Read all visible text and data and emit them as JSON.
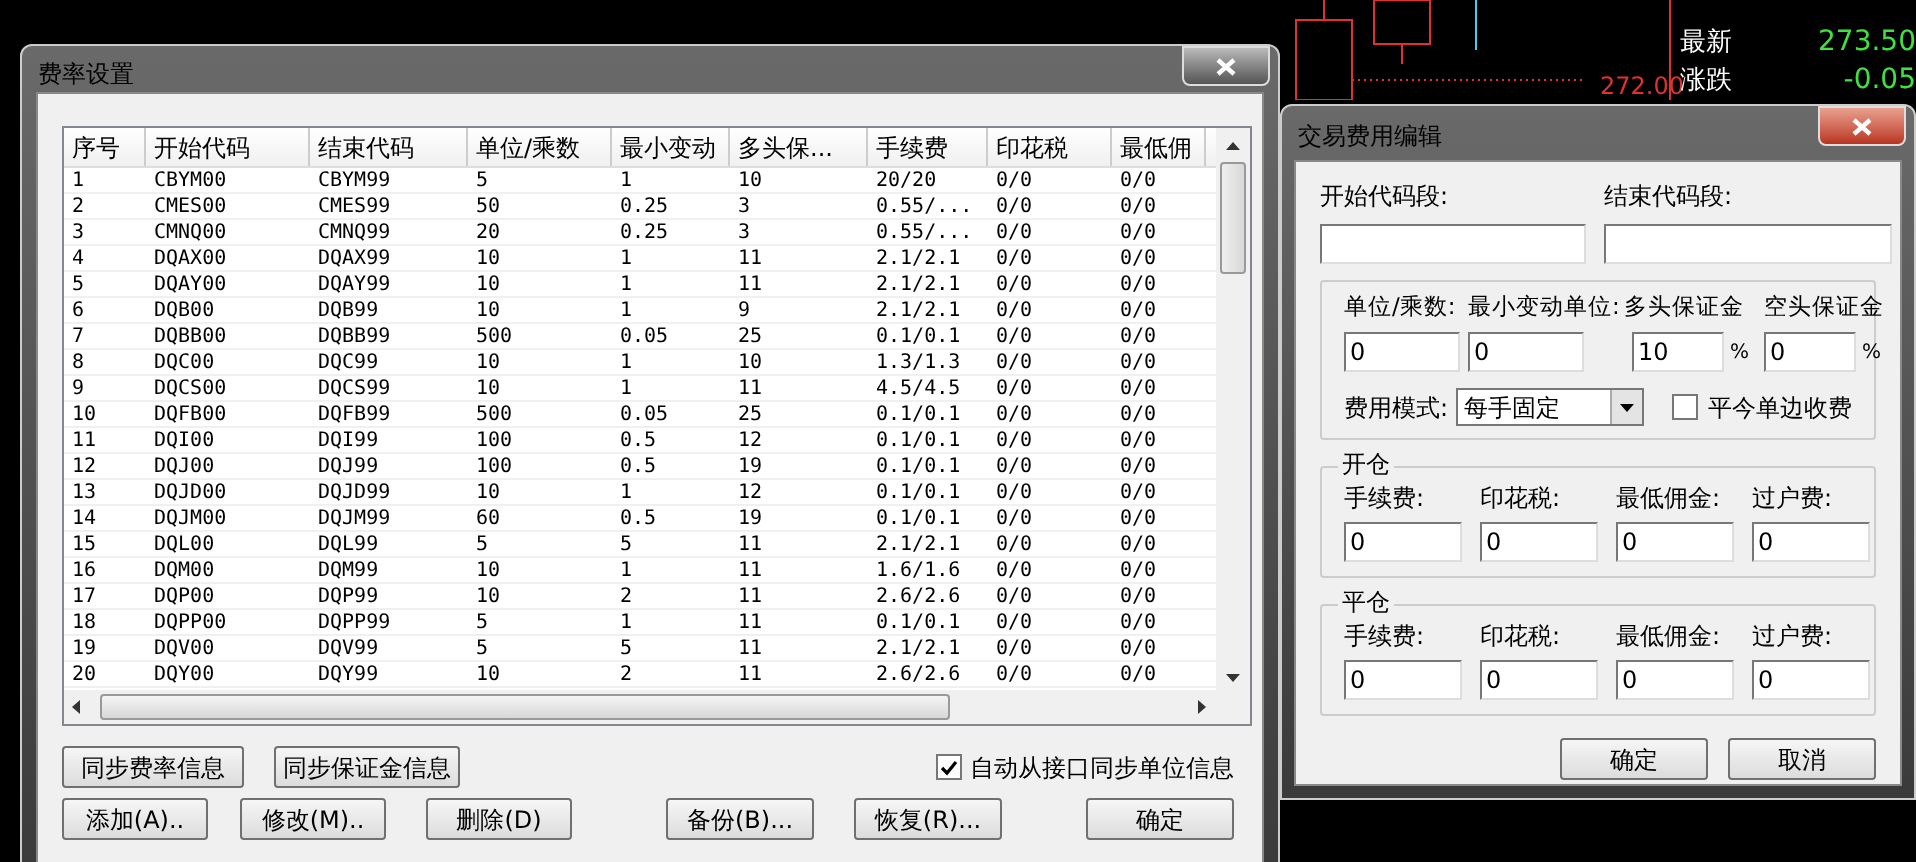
{
  "market_panel": {
    "quotes": [
      {
        "label": "最新",
        "value": "273.50"
      },
      {
        "label": "涨跌",
        "value": "-0.05"
      }
    ],
    "price_line": "272.00"
  },
  "fee_dialog": {
    "title": "费率设置",
    "table": {
      "columns": [
        "序号",
        "开始代码",
        "结束代码",
        "单位/乘数",
        "最小变动",
        "多头保...",
        "手续费",
        "印花税",
        "最低佣"
      ],
      "rows": [
        [
          "1",
          "CBYM00",
          "CBYM99",
          "5",
          "1",
          "10",
          "20/20",
          "0/0",
          "0/0"
        ],
        [
          "2",
          "CMES00",
          "CMES99",
          "50",
          "0.25",
          "3",
          "0.55/...",
          "0/0",
          "0/0"
        ],
        [
          "3",
          "CMNQ00",
          "CMNQ99",
          "20",
          "0.25",
          "3",
          "0.55/...",
          "0/0",
          "0/0"
        ],
        [
          "4",
          "DQAX00",
          "DQAX99",
          "10",
          "1",
          "11",
          "2.1/2.1",
          "0/0",
          "0/0"
        ],
        [
          "5",
          "DQAY00",
          "DQAY99",
          "10",
          "1",
          "11",
          "2.1/2.1",
          "0/0",
          "0/0"
        ],
        [
          "6",
          "DQB00",
          "DQB99",
          "10",
          "1",
          "9",
          "2.1/2.1",
          "0/0",
          "0/0"
        ],
        [
          "7",
          "DQBB00",
          "DQBB99",
          "500",
          "0.05",
          "25",
          "0.1/0.1",
          "0/0",
          "0/0"
        ],
        [
          "8",
          "DQC00",
          "DQC99",
          "10",
          "1",
          "10",
          "1.3/1.3",
          "0/0",
          "0/0"
        ],
        [
          "9",
          "DQCS00",
          "DQCS99",
          "10",
          "1",
          "11",
          "4.5/4.5",
          "0/0",
          "0/0"
        ],
        [
          "10",
          "DQFB00",
          "DQFB99",
          "500",
          "0.05",
          "25",
          "0.1/0.1",
          "0/0",
          "0/0"
        ],
        [
          "11",
          "DQI00",
          "DQI99",
          "100",
          "0.5",
          "12",
          "0.1/0.1",
          "0/0",
          "0/0"
        ],
        [
          "12",
          "DQJ00",
          "DQJ99",
          "100",
          "0.5",
          "19",
          "0.1/0.1",
          "0/0",
          "0/0"
        ],
        [
          "13",
          "DQJD00",
          "DQJD99",
          "10",
          "1",
          "12",
          "0.1/0.1",
          "0/0",
          "0/0"
        ],
        [
          "14",
          "DQJM00",
          "DQJM99",
          "60",
          "0.5",
          "19",
          "0.1/0.1",
          "0/0",
          "0/0"
        ],
        [
          "15",
          "DQL00",
          "DQL99",
          "5",
          "5",
          "11",
          "2.1/2.1",
          "0/0",
          "0/0"
        ],
        [
          "16",
          "DQM00",
          "DQM99",
          "10",
          "1",
          "11",
          "1.6/1.6",
          "0/0",
          "0/0"
        ],
        [
          "17",
          "DQP00",
          "DQP99",
          "10",
          "2",
          "11",
          "2.6/2.6",
          "0/0",
          "0/0"
        ],
        [
          "18",
          "DQPP00",
          "DQPP99",
          "5",
          "1",
          "11",
          "0.1/0.1",
          "0/0",
          "0/0"
        ],
        [
          "19",
          "DQV00",
          "DQV99",
          "5",
          "5",
          "11",
          "2.1/2.1",
          "0/0",
          "0/0"
        ],
        [
          "20",
          "DQY00",
          "DQY99",
          "10",
          "2",
          "11",
          "2.6/2.6",
          "0/0",
          "0/0"
        ]
      ]
    },
    "sync_buttons": [
      "同步费率信息",
      "同步保证金信息"
    ],
    "auto_sync": {
      "label": "自动从接口同步单位信息",
      "checked": true
    },
    "buttons": [
      "添加(A)..",
      "修改(M)..",
      "删除(D)",
      "备份(B)...",
      "恢复(R)...",
      "确定"
    ]
  },
  "edit_dialog": {
    "title": "交易费用编辑",
    "code_fields": [
      {
        "label": "开始代码段:"
      },
      {
        "label": "结束代码段:"
      }
    ],
    "unit_fields": [
      {
        "label": "单位/乘数:",
        "value": "0"
      },
      {
        "label": "最小变动单位:",
        "value": "0"
      },
      {
        "label": "多头保证金",
        "value": "10",
        "suffix": "%"
      },
      {
        "label": "空头保证金",
        "value": "0",
        "suffix": "%"
      }
    ],
    "fee_mode": {
      "label": "费用模式:",
      "value": "每手固定"
    },
    "close_today": {
      "label": "平今单边收费",
      "checked": false
    },
    "groups": [
      {
        "title": "开仓",
        "fields": [
          {
            "label": "手续费:",
            "value": "0"
          },
          {
            "label": "印花税:",
            "value": "0"
          },
          {
            "label": "最低佣金:",
            "value": "0"
          },
          {
            "label": "过户费:",
            "value": "0"
          }
        ]
      },
      {
        "title": "平仓",
        "fields": [
          {
            "label": "手续费:",
            "value": "0"
          },
          {
            "label": "印花税:",
            "value": "0"
          },
          {
            "label": "最低佣金:",
            "value": "0"
          },
          {
            "label": "过户费:",
            "value": "0"
          }
        ]
      }
    ],
    "buttons": [
      "确定",
      "取消"
    ]
  }
}
